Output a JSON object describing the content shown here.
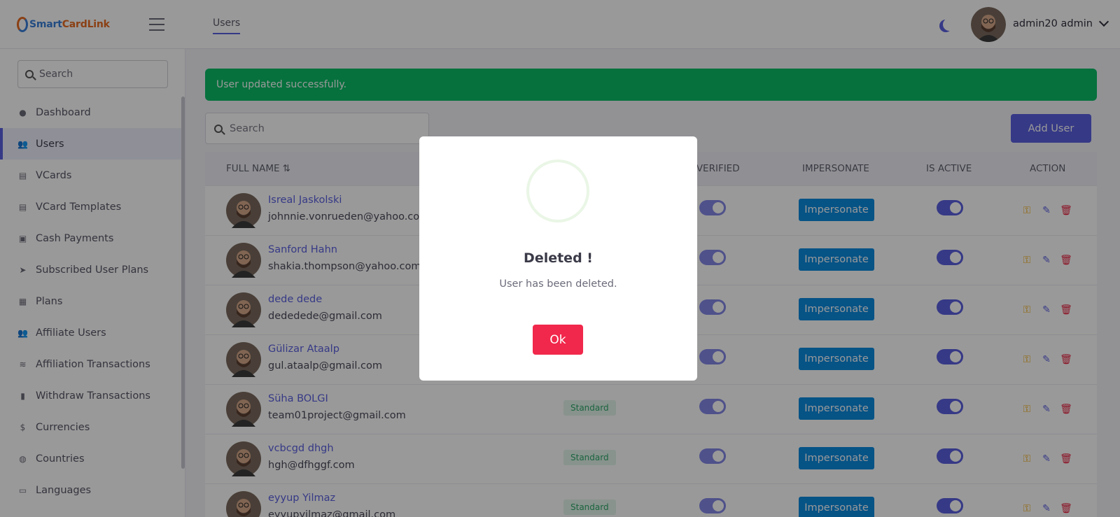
{
  "app": {
    "logo_part1": "S",
    "logo_part2": "mart",
    "logo_part3": "CardLink",
    "top_tab": "Users",
    "user_name": "admin20 admin"
  },
  "sidebar": {
    "search_placeholder": "Search",
    "items": [
      {
        "label": "Dashboard",
        "icon": "dashboard-icon",
        "glyph": "●"
      },
      {
        "label": "Users",
        "icon": "users-icon",
        "glyph": "👥"
      },
      {
        "label": "VCards",
        "icon": "vcard-icon",
        "glyph": "▤"
      },
      {
        "label": "VCard Templates",
        "icon": "template-icon",
        "glyph": "▤"
      },
      {
        "label": "Cash Payments",
        "icon": "money-icon",
        "glyph": "▣"
      },
      {
        "label": "Subscribed User Plans",
        "icon": "paper-plane-icon",
        "glyph": "➤"
      },
      {
        "label": "Plans",
        "icon": "plans-icon",
        "glyph": "▦"
      },
      {
        "label": "Affiliate Users",
        "icon": "affiliate-users-icon",
        "glyph": "👥"
      },
      {
        "label": "Affiliation Transactions",
        "icon": "coins-icon",
        "glyph": "≋"
      },
      {
        "label": "Withdraw Transactions",
        "icon": "receipt-icon",
        "glyph": "▮"
      },
      {
        "label": "Currencies",
        "icon": "dollar-icon",
        "glyph": "$"
      },
      {
        "label": "Countries",
        "icon": "globe-icon",
        "glyph": "◍"
      },
      {
        "label": "Languages",
        "icon": "language-icon",
        "glyph": "▭"
      }
    ]
  },
  "main": {
    "alert": "User updated successfully.",
    "search_placeholder": "Search",
    "add_user": "Add User",
    "columns": {
      "full_name": "FULL NAME",
      "sort_glyph": "⇅",
      "email_verified": "L VERIFIED",
      "impersonate": "IMPERSONATE",
      "is_active": "IS ACTIVE",
      "action": "ACTION"
    },
    "impersonate_label": "Impersonate",
    "rows": [
      {
        "name": "Isreal Jaskolski",
        "email": "johnnie.vonrueden@yahoo.com",
        "plan": ""
      },
      {
        "name": "Sanford Hahn",
        "email": "shakia.thompson@yahoo.com",
        "plan": ""
      },
      {
        "name": "dede dede",
        "email": "dededede@gmail.com",
        "plan": ""
      },
      {
        "name": "Gülizar Ataalp",
        "email": "gul.ataalp@gmail.com",
        "plan": ""
      },
      {
        "name": "Süha BOLGI",
        "email": "team01project@gmail.com",
        "plan": "Standard"
      },
      {
        "name": "vcbcgd dhgh",
        "email": "hgh@dfhggf.com",
        "plan": "Standard"
      },
      {
        "name": "eyyup Yilmaz",
        "email": "eyyupyilmaz@gmail.com",
        "plan": "Standard"
      }
    ]
  },
  "modal": {
    "title": "Deleted !",
    "text": "User has been deleted.",
    "ok": "Ok"
  },
  "colors": {
    "accent": "#5b5fe0",
    "success": "#0abd66",
    "impersonate": "#0a8be0",
    "danger": "#f1284b",
    "key": "#f2a90d"
  }
}
